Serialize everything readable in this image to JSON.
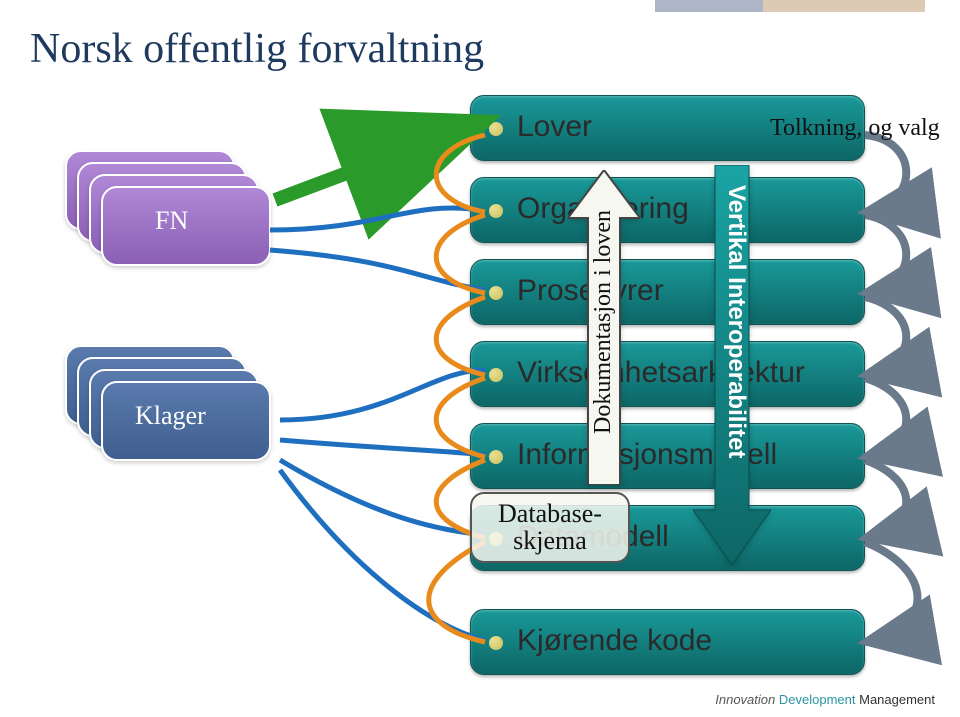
{
  "title": "Norsk offentlig forvaltning",
  "left_top": {
    "label": "FN"
  },
  "left_bottom": {
    "label": "Klager"
  },
  "layers": [
    {
      "label": "Lover"
    },
    {
      "label": "Organisering"
    },
    {
      "label": "Prosedyrer"
    },
    {
      "label": "Virksomhetsarkitektur"
    },
    {
      "label": "Informasjonsmodell"
    },
    {
      "label": "Datamodell"
    },
    {
      "label": "Kjørende kode"
    }
  ],
  "annotations": {
    "tolkning": "Tolkning, og valg",
    "dokumentasjon": "Dokumentasjon i loven",
    "vertikal": "Vertikal Interoperabilitet",
    "database": "Database-\nskjema"
  },
  "brand": {
    "a": "Innovation",
    "b": "Development",
    "c": "Management"
  }
}
